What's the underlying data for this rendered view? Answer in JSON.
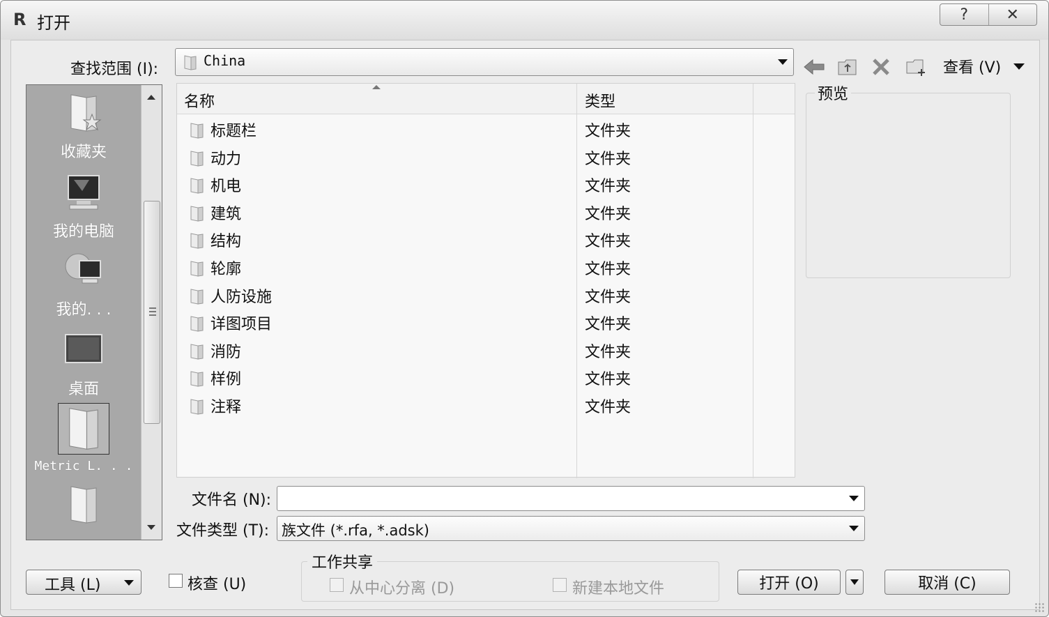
{
  "window": {
    "title": "打开",
    "help_glyph": "?",
    "close_glyph": "✕"
  },
  "look_in": {
    "label": "查找范围 (I):",
    "value": "China"
  },
  "toolbar": {
    "icons": [
      "back-icon",
      "up-folder-icon",
      "delete-icon",
      "new-folder-icon"
    ],
    "view_label": "查看 (V)"
  },
  "places": [
    {
      "label": "收藏夹",
      "icon": "favorites-icon"
    },
    {
      "label": "我的电脑",
      "icon": "my-computer-icon"
    },
    {
      "label": "我的. . .",
      "icon": "network-icon"
    },
    {
      "label": "桌面",
      "icon": "desktop-icon"
    },
    {
      "label": "Metric L. . .",
      "icon": "folder-icon"
    },
    {
      "label": "",
      "icon": "folder-icon"
    }
  ],
  "file_list": {
    "columns": [
      "名称",
      "类型"
    ],
    "rows": [
      {
        "name": "标题栏",
        "type": "文件夹"
      },
      {
        "name": "动力",
        "type": "文件夹"
      },
      {
        "name": "机电",
        "type": "文件夹"
      },
      {
        "name": "建筑",
        "type": "文件夹"
      },
      {
        "name": "结构",
        "type": "文件夹"
      },
      {
        "name": "轮廓",
        "type": "文件夹"
      },
      {
        "name": "人防设施",
        "type": "文件夹"
      },
      {
        "name": "详图项目",
        "type": "文件夹"
      },
      {
        "name": "消防",
        "type": "文件夹"
      },
      {
        "name": "样例",
        "type": "文件夹"
      },
      {
        "name": "注释",
        "type": "文件夹"
      }
    ]
  },
  "preview": {
    "label": "预览"
  },
  "file_name": {
    "label": "文件名 (N):",
    "value": ""
  },
  "file_type": {
    "label": "文件类型 (T):",
    "value": "族文件 (*.rfa, *.adsk)"
  },
  "tools_button": "工具 (L)",
  "audit": {
    "label": "核查 (U)",
    "checked": false
  },
  "worksharing": {
    "label": "工作共享",
    "detach_label": "从中心分离 (D)",
    "create_local_label": "新建本地文件"
  },
  "open_button": "打开 (O)",
  "cancel_button": "取消 (C)"
}
